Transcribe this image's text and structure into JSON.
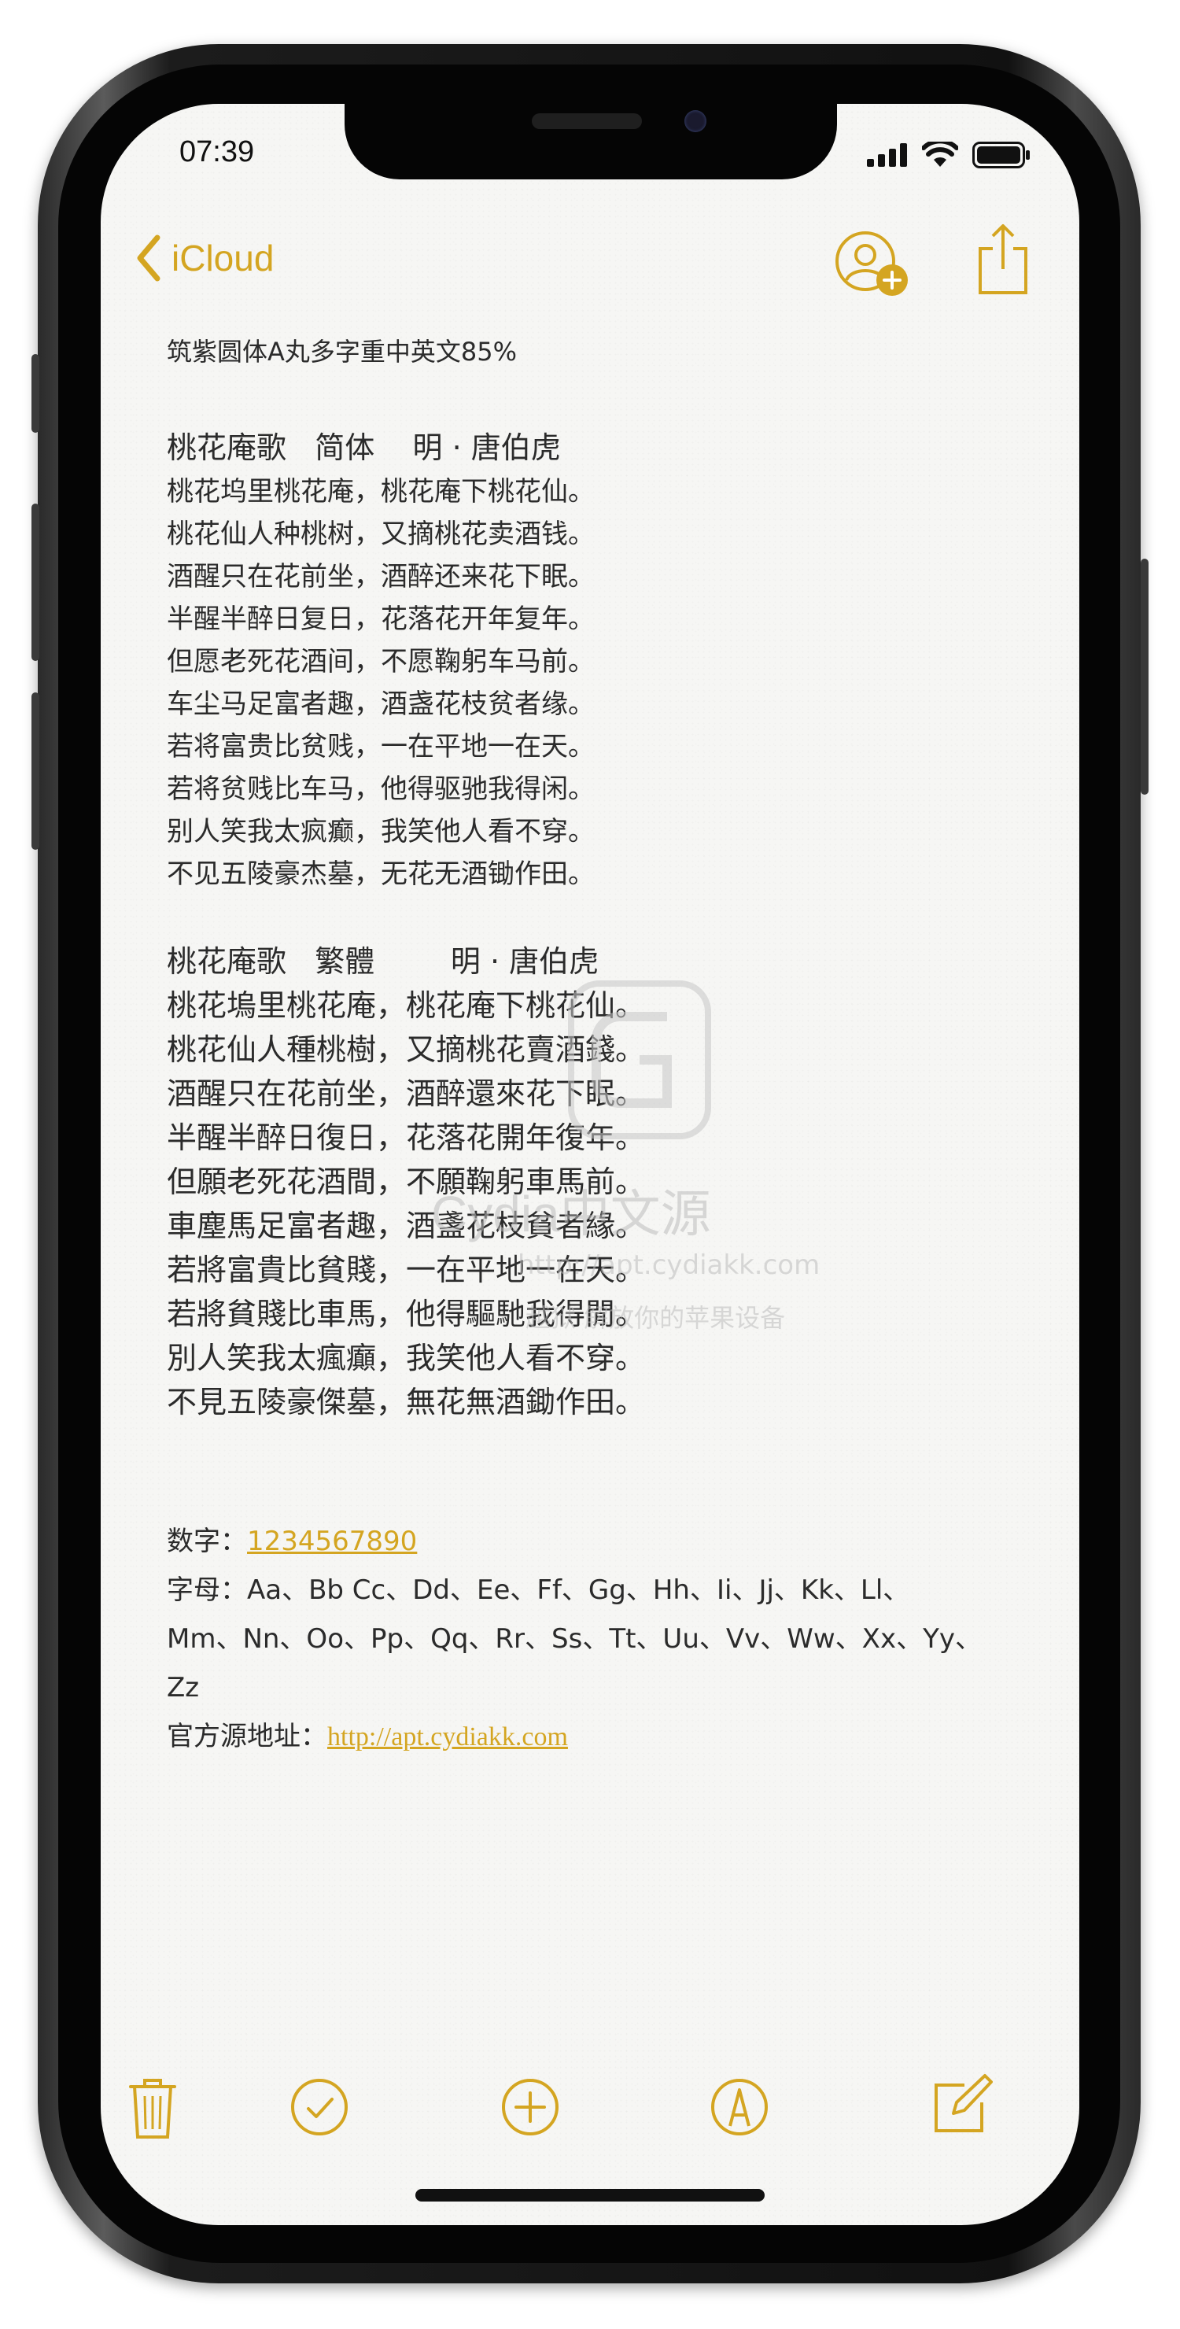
{
  "status_bar": {
    "time": "07:39"
  },
  "nav": {
    "back_label": "iCloud",
    "icons": [
      "chevron-left-icon",
      "add-person-icon",
      "share-icon"
    ]
  },
  "note": {
    "font_line": "筑紫圆体A丸多字重中英文85%",
    "simplified_heading": "桃花庵歌   简体    明 · 唐伯虎",
    "simplified_lines": [
      "桃花坞里桃花庵，桃花庵下桃花仙。",
      "桃花仙人种桃树，又摘桃花卖酒钱。",
      "酒醒只在花前坐，酒醉还来花下眠。",
      "半醒半醉日复日，花落花开年复年。",
      "但愿老死花酒间，不愿鞠躬车马前。",
      "车尘马足富者趣，酒盏花枝贫者缘。",
      "若将富贵比贫贱，一在平地一在天。",
      "若将贫贱比车马，他得驱驰我得闲。",
      "别人笑我太疯癫，我笑他人看不穿。",
      "不见五陵豪杰墓，无花无酒锄作田。"
    ],
    "traditional_heading": "桃花庵歌   繁體        明 · 唐伯虎",
    "traditional_lines": [
      "桃花塢里桃花庵，桃花庵下桃花仙。",
      "桃花仙人種桃樹，又摘桃花賣酒錢。",
      "酒醒只在花前坐，酒醉還來花下眠。",
      "半醒半醉日復日，花落花開年復年。",
      "但願老死花酒間，不願鞠躬車馬前。",
      "車塵馬足富者趣，酒盞花枝貧者緣。",
      "若將富貴比貧賤，一在平地一在天。",
      "若將貧賤比車馬，他得驅馳我得閒。",
      "別人笑我太瘋癲，我笑他人看不穿。",
      "不見五陵豪傑墓，無花無酒鋤作田。"
    ],
    "digits_label": "数字：",
    "digits_value": "1234567890",
    "letters_label": "字母：",
    "letters_line1": "Aa、Bb Cc、Dd、Ee、Ff、Gg、Hh、Ii、Jj、Kk、Ll、",
    "letters_line2": "Mm、Nn、Oo、Pp、Qq、Rr、Ss、Tt、Uu、Vv、Ww、Xx、Yy、",
    "letters_line3": "Zz",
    "source_label": "官方源地址：",
    "source_url": "http://apt.cydiakk.com"
  },
  "watermark": {
    "big": "Cydia中文源",
    "url": "http://apt.cydiakk.com",
    "sub": "越狱 解放你的苹果设备"
  },
  "toolbar": {
    "icons": [
      "trash-icon",
      "checklist-icon",
      "add-icon",
      "markup-icon",
      "compose-icon"
    ]
  },
  "colors": {
    "accent": "#d4a521",
    "text": "#2b2b2b",
    "paper": "#f6f6f4"
  }
}
